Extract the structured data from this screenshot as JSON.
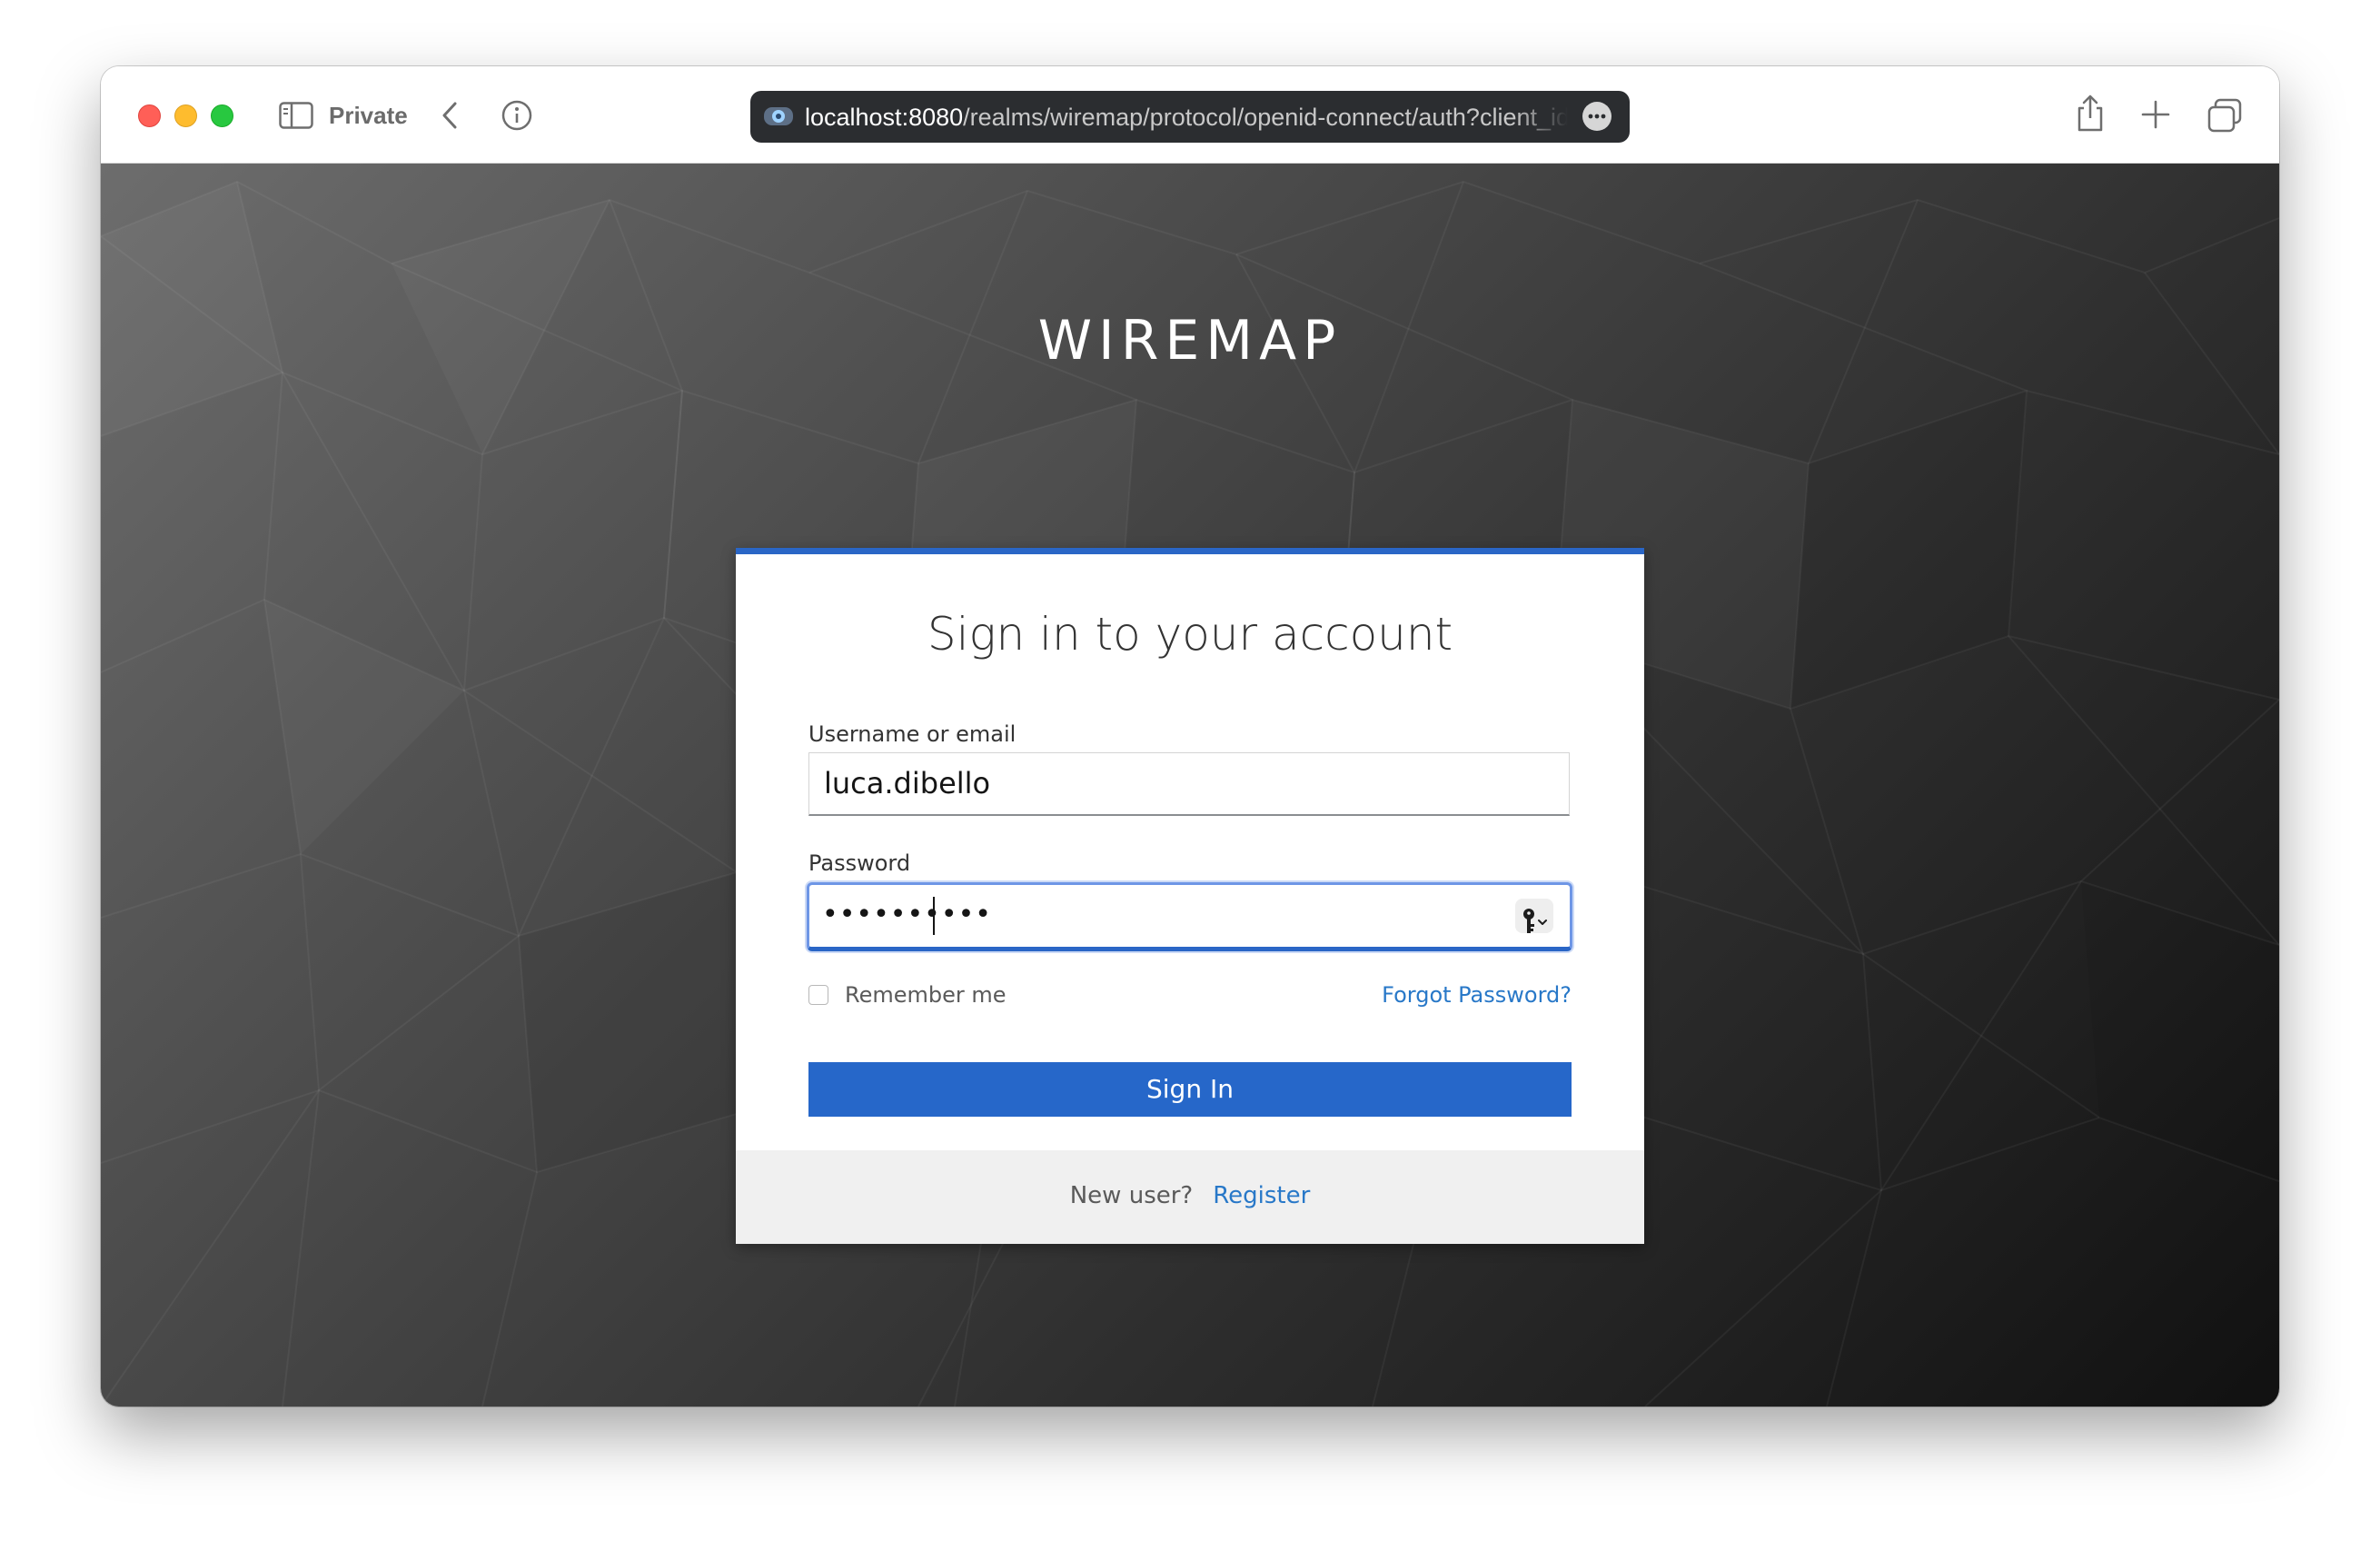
{
  "browser": {
    "mode_label": "Private",
    "url_host": "localhost:8080",
    "url_path": "/realms/wiremap/protocol/openid-connect/auth?client_id=wiremap",
    "icons": [
      "sidebar-icon",
      "back-icon",
      "info-icon",
      "site-icon",
      "more-icon",
      "share-icon",
      "new-tab-icon",
      "tabs-overview-icon"
    ]
  },
  "page": {
    "brand": "WIREMAP"
  },
  "login": {
    "title": "Sign in to your account",
    "username_label": "Username or email",
    "username_value": "luca.dibello",
    "password_label": "Password",
    "password_masked": "••••••••••",
    "remember_label": "Remember me",
    "remember_checked": false,
    "forgot_link": "Forgot Password?",
    "submit_label": "Sign In",
    "new_user_text": "New user?",
    "register_link": "Register"
  },
  "colors": {
    "accent": "#2a66c6",
    "link": "#2878c8",
    "focus_ring": "#6e96e6",
    "close": "#ff5f57",
    "minimize": "#febc2e",
    "zoom": "#28c840"
  }
}
